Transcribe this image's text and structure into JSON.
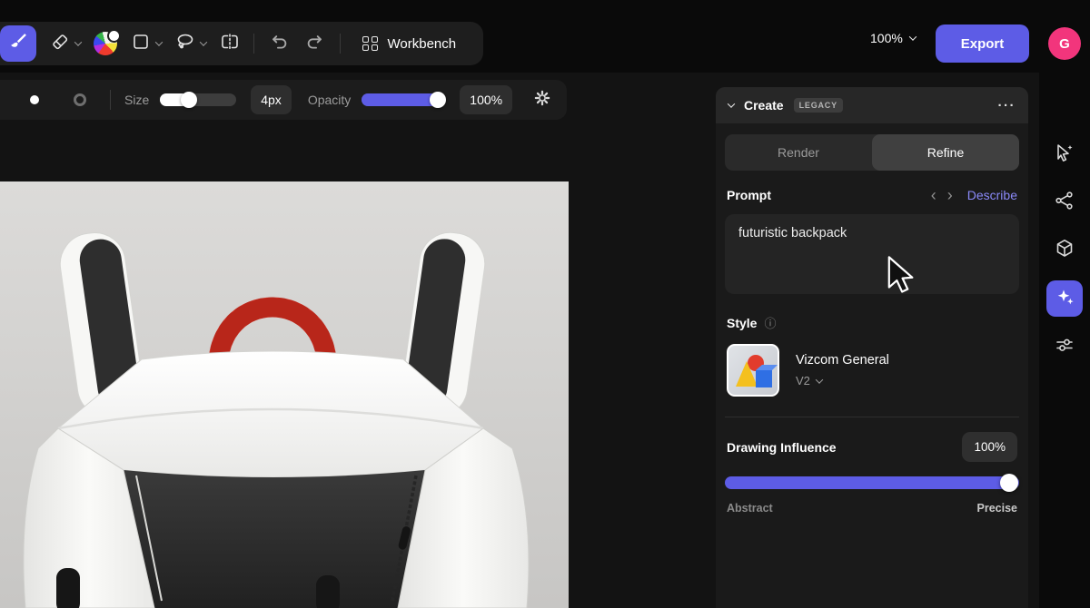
{
  "topbar": {
    "workbench_label": "Workbench",
    "zoom_value": "100%",
    "export_label": "Export",
    "avatar_initial": "G"
  },
  "tool_options": {
    "size_label": "Size",
    "size_value": "4px",
    "opacity_label": "Opacity",
    "opacity_value": "100%"
  },
  "panel": {
    "title": "Create",
    "badge": "LEGACY",
    "menu_icon": "···",
    "tabs": [
      {
        "label": "Render",
        "active": false
      },
      {
        "label": "Refine",
        "active": true
      }
    ],
    "prompt": {
      "label": "Prompt",
      "prev_icon": "‹",
      "next_icon": "›",
      "describe_label": "Describe",
      "value": "futuristic backpack"
    },
    "style": {
      "label": "Style",
      "info_icon": "ⓘ",
      "name": "Vizcom General",
      "version": "V2"
    },
    "influence": {
      "label": "Drawing Influence",
      "value": "100%",
      "percent": 100,
      "min_label": "Abstract",
      "max_label": "Precise"
    }
  },
  "colors": {
    "accent": "#5d5ce6",
    "link": "#8a89f8",
    "avatar_pink": "#f2357c",
    "handle_red": "#cf2d20"
  }
}
